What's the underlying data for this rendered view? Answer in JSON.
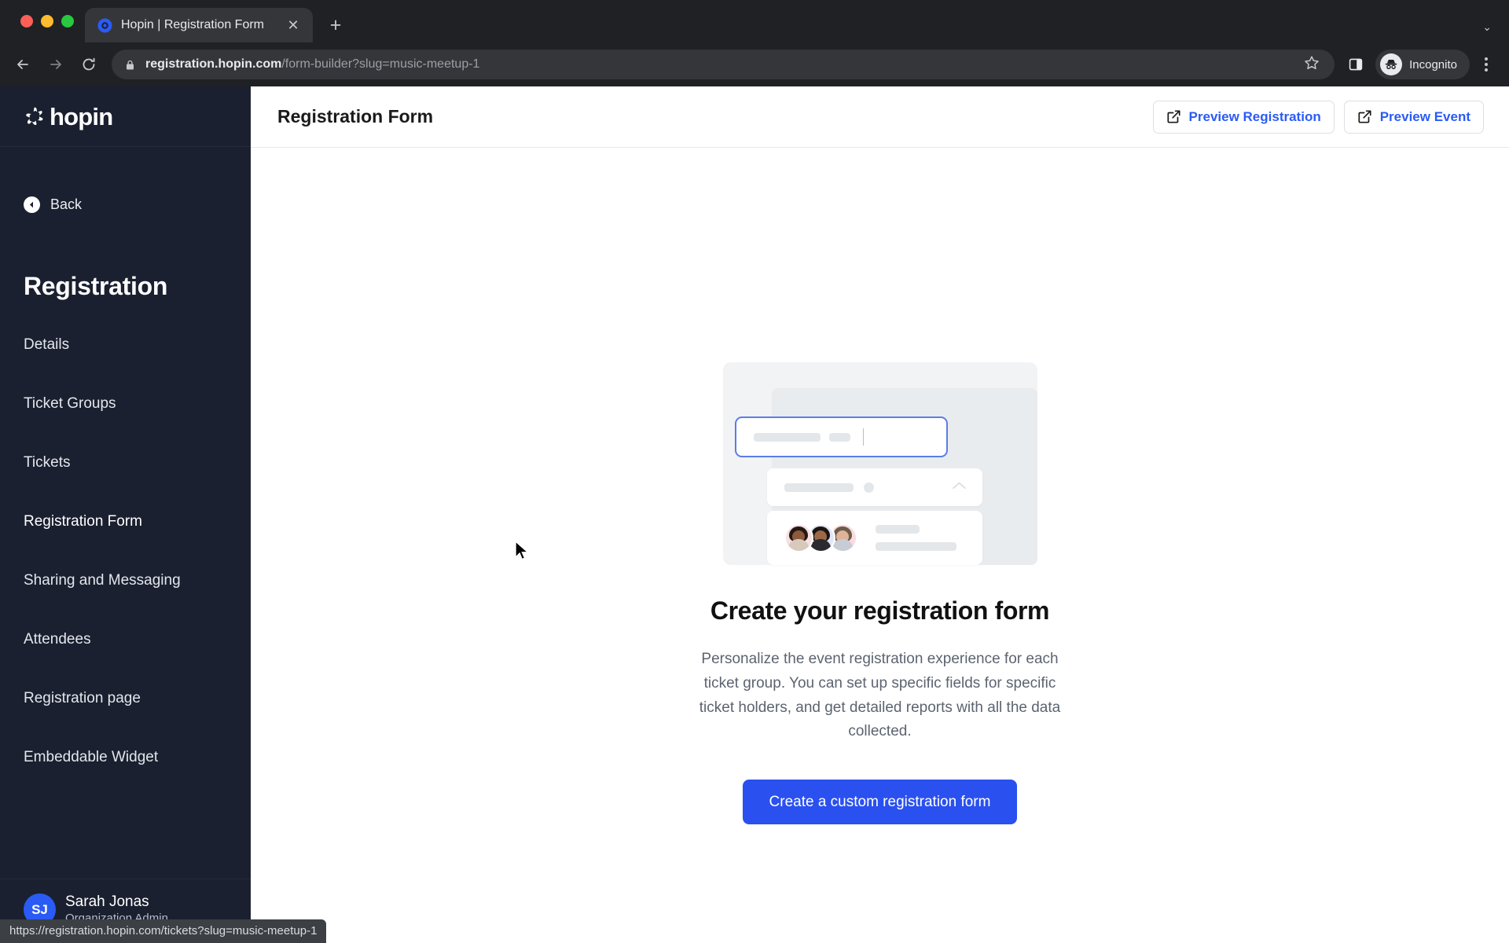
{
  "browser": {
    "tab": {
      "title": "Hopin | Registration Form",
      "favicon_name": "hopin-favicon",
      "close_label": "✕"
    },
    "new_tab_label": "+",
    "tabstrip_caret": "⌄",
    "toolbar": {
      "back_label": "←",
      "forward_label": "→",
      "reload_label": "⟳",
      "lock_icon": "lock-icon",
      "url_host": "registration.hopin.com",
      "url_path": "/form-builder?slug=music-meetup-1",
      "url_full": "registration.hopin.com/form-builder?slug=music-meetup-1",
      "star_icon": "bookmark-star-icon",
      "side_panel_icon": "side-panel-icon",
      "profile_label": "Incognito",
      "menu_icon": "kebab-menu-icon"
    },
    "status_bubble_url": "https://registration.hopin.com/tickets?slug=music-meetup-1"
  },
  "sidebar": {
    "brand": "hopin",
    "back_label": "Back",
    "heading": "Registration",
    "items": [
      {
        "label": "Details",
        "active": false
      },
      {
        "label": "Ticket Groups",
        "active": false
      },
      {
        "label": "Tickets",
        "active": false
      },
      {
        "label": "Registration Form",
        "active": true
      },
      {
        "label": "Sharing and Messaging",
        "active": false
      },
      {
        "label": "Attendees",
        "active": false
      },
      {
        "label": "Registration page",
        "active": false
      },
      {
        "label": "Embeddable Widget",
        "active": false
      }
    ],
    "user": {
      "initials": "SJ",
      "name": "Sarah Jonas",
      "role": "Organization Admin"
    }
  },
  "main": {
    "page_title": "Registration Form",
    "actions": [
      {
        "label": "Preview Registration",
        "icon": "external-link-icon"
      },
      {
        "label": "Preview Event",
        "icon": "external-link-icon"
      }
    ],
    "empty_state": {
      "illustration_name": "registration-form-illustration",
      "title": "Create your registration form",
      "description": "Personalize the event registration experience for each ticket group. You can set up specific fields for specific ticket holders, and get detailed reports with all the data collected.",
      "cta_label": "Create a custom registration form"
    }
  },
  "colors": {
    "accent_blue": "#2a50f0",
    "link_blue": "#2a5bf5",
    "sidebar_bg": "#1b2030",
    "browser_chrome": "#202124",
    "illustration_outline": "#5b7ce8"
  }
}
